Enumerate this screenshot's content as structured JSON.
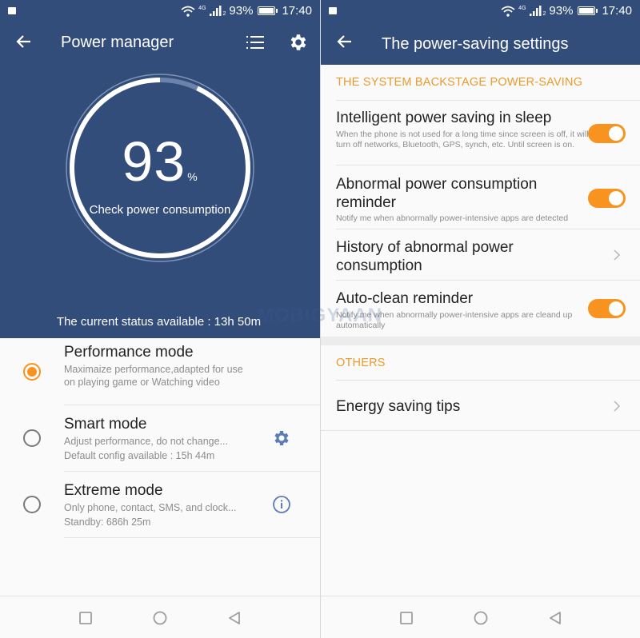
{
  "status_bar": {
    "network": "4G",
    "sim_slot": "2",
    "battery_percent": "93%",
    "time": "17:40"
  },
  "left_screen": {
    "title": "Power manager",
    "battery_level": 93,
    "battery_value": "93",
    "battery_unit": "%",
    "check_label": "Check power consumption",
    "current_status": "The current status available : 13h 50m",
    "modes": [
      {
        "title": "Performance mode",
        "desc": "Maximaize performance,adapted for use on playing game or Watching video",
        "selected": true
      },
      {
        "title": "Smart mode",
        "desc": "Adjust performance, do not change...",
        "extra": "Default config available : 15h 44m",
        "selected": false,
        "icon": "gear-icon"
      },
      {
        "title": "Extreme mode",
        "desc": "Only phone, contact, SMS, and clock...",
        "extra": "Standby: 686h 25m",
        "selected": false,
        "icon": "info-icon"
      }
    ]
  },
  "right_screen": {
    "title": "The power-saving settings",
    "section1": "THE SYSTEM BACKSTAGE POWER-SAVING",
    "settings": [
      {
        "title": "Intelligent power saving in sleep",
        "desc": "When the phone is not used for a long time since screen is off, it will turn off networks, Bluetooth, GPS, synch, etc. Until screen is on.",
        "toggle": true
      },
      {
        "title": "Abnormal power consumption reminder",
        "desc": "Notify me when abnormally power-intensive apps are detected",
        "toggle": true
      },
      {
        "title": "History of abnormal power consumption",
        "chevron": true
      },
      {
        "title": "Auto-clean reminder",
        "desc": "Notify me when abnormally power-intensive apps are cleand up automatically",
        "toggle": true
      }
    ],
    "section2": "OTHERS",
    "others": [
      {
        "title": "Energy saving tips",
        "chevron": true
      }
    ]
  },
  "watermark": "MOBIGYAAN",
  "colors": {
    "primary": "#324d7a",
    "accent": "#f7931e",
    "section_header": "#ec9a2a"
  }
}
